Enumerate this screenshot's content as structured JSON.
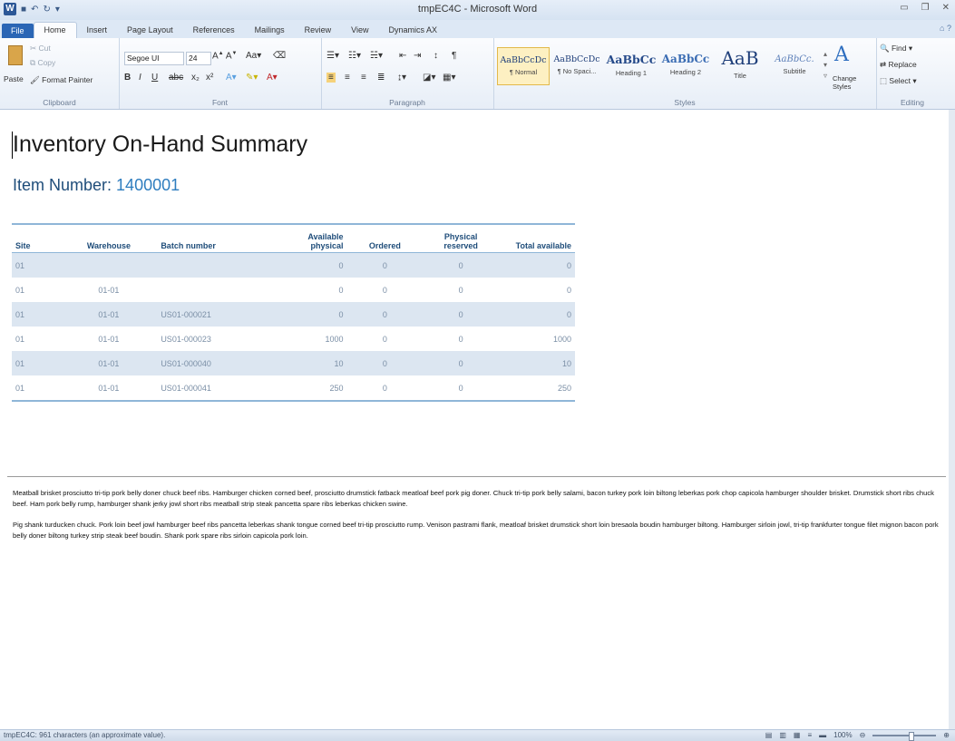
{
  "window": {
    "title": "tmpEC4C - Microsoft Word"
  },
  "qat": {
    "undo_glyph": "↶",
    "redo_glyph": "↻"
  },
  "tabs": [
    "File",
    "Home",
    "Insert",
    "Page Layout",
    "References",
    "Mailings",
    "Review",
    "View",
    "Dynamics AX"
  ],
  "ribbon": {
    "clipboard": {
      "paste": "Paste",
      "cut": "Cut",
      "copy": "Copy",
      "format_painter": "Format Painter",
      "label": "Clipboard"
    },
    "font": {
      "name": "Segoe UI",
      "size": "24",
      "label": "Font"
    },
    "paragraph": {
      "label": "Paragraph"
    },
    "styles": {
      "label": "Styles",
      "items": [
        {
          "preview": "AaBbCcDc",
          "name": "¶ Normal"
        },
        {
          "preview": "AaBbCcDc",
          "name": "¶ No Spaci..."
        },
        {
          "preview": "AaBbCc",
          "name": "Heading 1"
        },
        {
          "preview": "AaBbCc",
          "name": "Heading 2"
        },
        {
          "preview": "AaB",
          "name": "Title"
        },
        {
          "preview": "AaBbCc.",
          "name": "Subtitle"
        }
      ],
      "change_styles": "Change Styles"
    },
    "editing": {
      "find": "Find",
      "replace": "Replace",
      "select": "Select",
      "label": "Editing"
    }
  },
  "document": {
    "title": "Inventory On-Hand Summary",
    "item_label": "Item Number:",
    "item_value": "1400001",
    "table": {
      "headers": [
        "Site",
        "Warehouse",
        "Batch number",
        "Available physical",
        "Ordered",
        "Physical reserved",
        "Total available"
      ],
      "rows": [
        [
          "01",
          "",
          "",
          "0",
          "0",
          "0",
          "0"
        ],
        [
          "01",
          "01-01",
          "",
          "0",
          "0",
          "0",
          "0"
        ],
        [
          "01",
          "01-01",
          "US01-000021",
          "0",
          "0",
          "0",
          "0"
        ],
        [
          "01",
          "01-01",
          "US01-000023",
          "1000",
          "0",
          "0",
          "1000"
        ],
        [
          "01",
          "01-01",
          "US01-000040",
          "10",
          "0",
          "0",
          "10"
        ],
        [
          "01",
          "01-01",
          "US01-000041",
          "250",
          "0",
          "0",
          "250"
        ]
      ]
    },
    "paragraph1": "Meatball brisket prosciutto tri-tip pork belly doner chuck beef ribs. Hamburger chicken corned beef, prosciutto drumstick fatback meatloaf beef pork pig doner. Chuck tri-tip pork belly salami, bacon turkey pork loin biltong leberkas pork chop capicola hamburger shoulder brisket. Drumstick short ribs chuck beef. Ham pork belly rump, hamburger shank jerky jowl short ribs meatball strip steak pancetta spare ribs leberkas chicken swine.",
    "paragraph2": "Pig shank turducken chuck. Pork loin beef jowl hamburger beef ribs pancetta leberkas shank tongue corned beef tri-tip prosciutto rump. Venison pastrami flank, meatloaf brisket drumstick short loin bresaola boudin hamburger biltong. Hamburger sirloin jowl, tri-tip frankfurter tongue filet mignon bacon pork belly doner biltong turkey strip steak beef boudin. Shank pork spare ribs sirloin capicola pork loin."
  },
  "status": {
    "text": "tmpEC4C: 961 characters (an approximate value).",
    "zoom": "100%"
  }
}
